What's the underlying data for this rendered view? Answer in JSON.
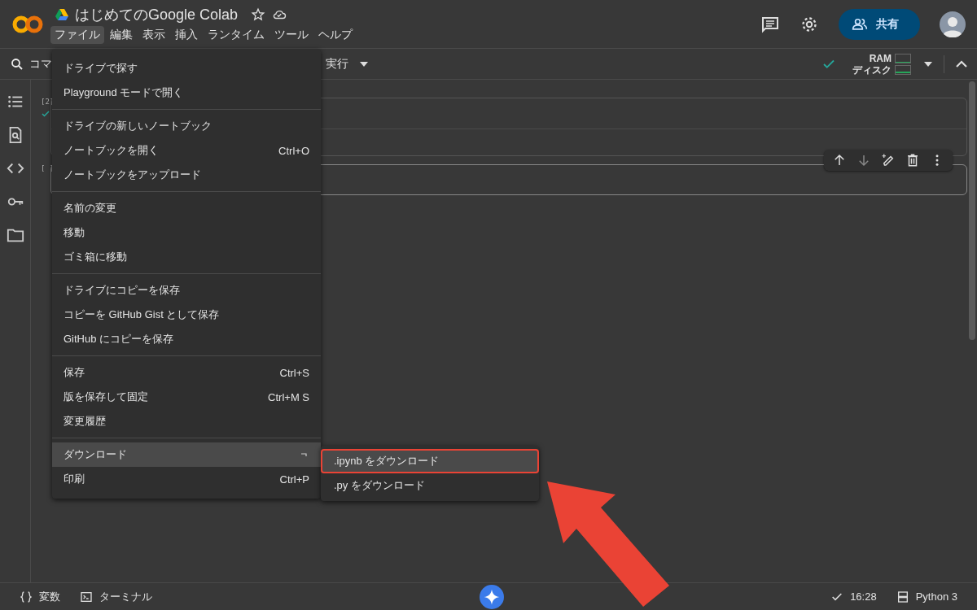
{
  "header": {
    "title": "はじめてのGoogle Colab",
    "menus": [
      {
        "label": "ファイル",
        "selected": true
      },
      {
        "label": "編集",
        "selected": false
      },
      {
        "label": "表示",
        "selected": false
      },
      {
        "label": "挿入",
        "selected": false
      },
      {
        "label": "ランタイム",
        "selected": false
      },
      {
        "label": "ツール",
        "selected": false
      },
      {
        "label": "ヘルプ",
        "selected": false
      }
    ],
    "share": "共有"
  },
  "toolbar": {
    "search": "コマ",
    "run": "実行",
    "ram": {
      "label": "RAM"
    },
    "disk": {
      "label": "ディスク"
    }
  },
  "cells": [
    {
      "exec": "[2]",
      "done": true
    },
    {
      "exec": "[ ]",
      "done": false
    }
  ],
  "file_menu": {
    "sections": [
      {
        "items": [
          {
            "label": "ドライブで探す",
            "selected": false,
            "submenu": false
          },
          {
            "label": "Playground モードで開く",
            "selected": false,
            "submenu": false
          }
        ]
      },
      {
        "items": [
          {
            "label": "ドライブの新しいノートブック",
            "selected": false,
            "submenu": false
          },
          {
            "label": "ノートブックを開く",
            "shortcut": "Ctrl+O",
            "selected": false,
            "submenu": false
          },
          {
            "label": "ノートブックをアップロード",
            "selected": false,
            "submenu": false
          }
        ]
      },
      {
        "items": [
          {
            "label": "名前の変更",
            "selected": false,
            "submenu": false
          },
          {
            "label": "移動",
            "selected": false,
            "submenu": false
          },
          {
            "label": "ゴミ箱に移動",
            "selected": false,
            "submenu": false
          }
        ]
      },
      {
        "items": [
          {
            "label": "ドライブにコピーを保存",
            "selected": false,
            "submenu": false
          },
          {
            "label": "コピーを GitHub Gist として保存",
            "selected": false,
            "submenu": false
          },
          {
            "label": "GitHub にコピーを保存",
            "selected": false,
            "submenu": false
          }
        ]
      },
      {
        "items": [
          {
            "label": "保存",
            "shortcut": "Ctrl+S",
            "selected": false,
            "submenu": false
          },
          {
            "label": "版を保存して固定",
            "shortcut": "Ctrl+M S",
            "selected": false,
            "submenu": false
          },
          {
            "label": "変更履歴",
            "selected": false,
            "submenu": false
          }
        ]
      },
      {
        "items": [
          {
            "label": "ダウンロード",
            "selected": true,
            "submenu": true
          },
          {
            "label": "印刷",
            "shortcut": "Ctrl+P",
            "selected": false,
            "submenu": false
          }
        ]
      }
    ]
  },
  "download_menu": {
    "items": [
      {
        "label": ".ipynb をダウンロード",
        "selected": true
      },
      {
        "label": ".py をダウンロード",
        "selected": false
      }
    ]
  },
  "status_bar": {
    "variables": "変数",
    "terminal": "ターミナル",
    "time": "16:28",
    "runtime": "Python 3"
  }
}
